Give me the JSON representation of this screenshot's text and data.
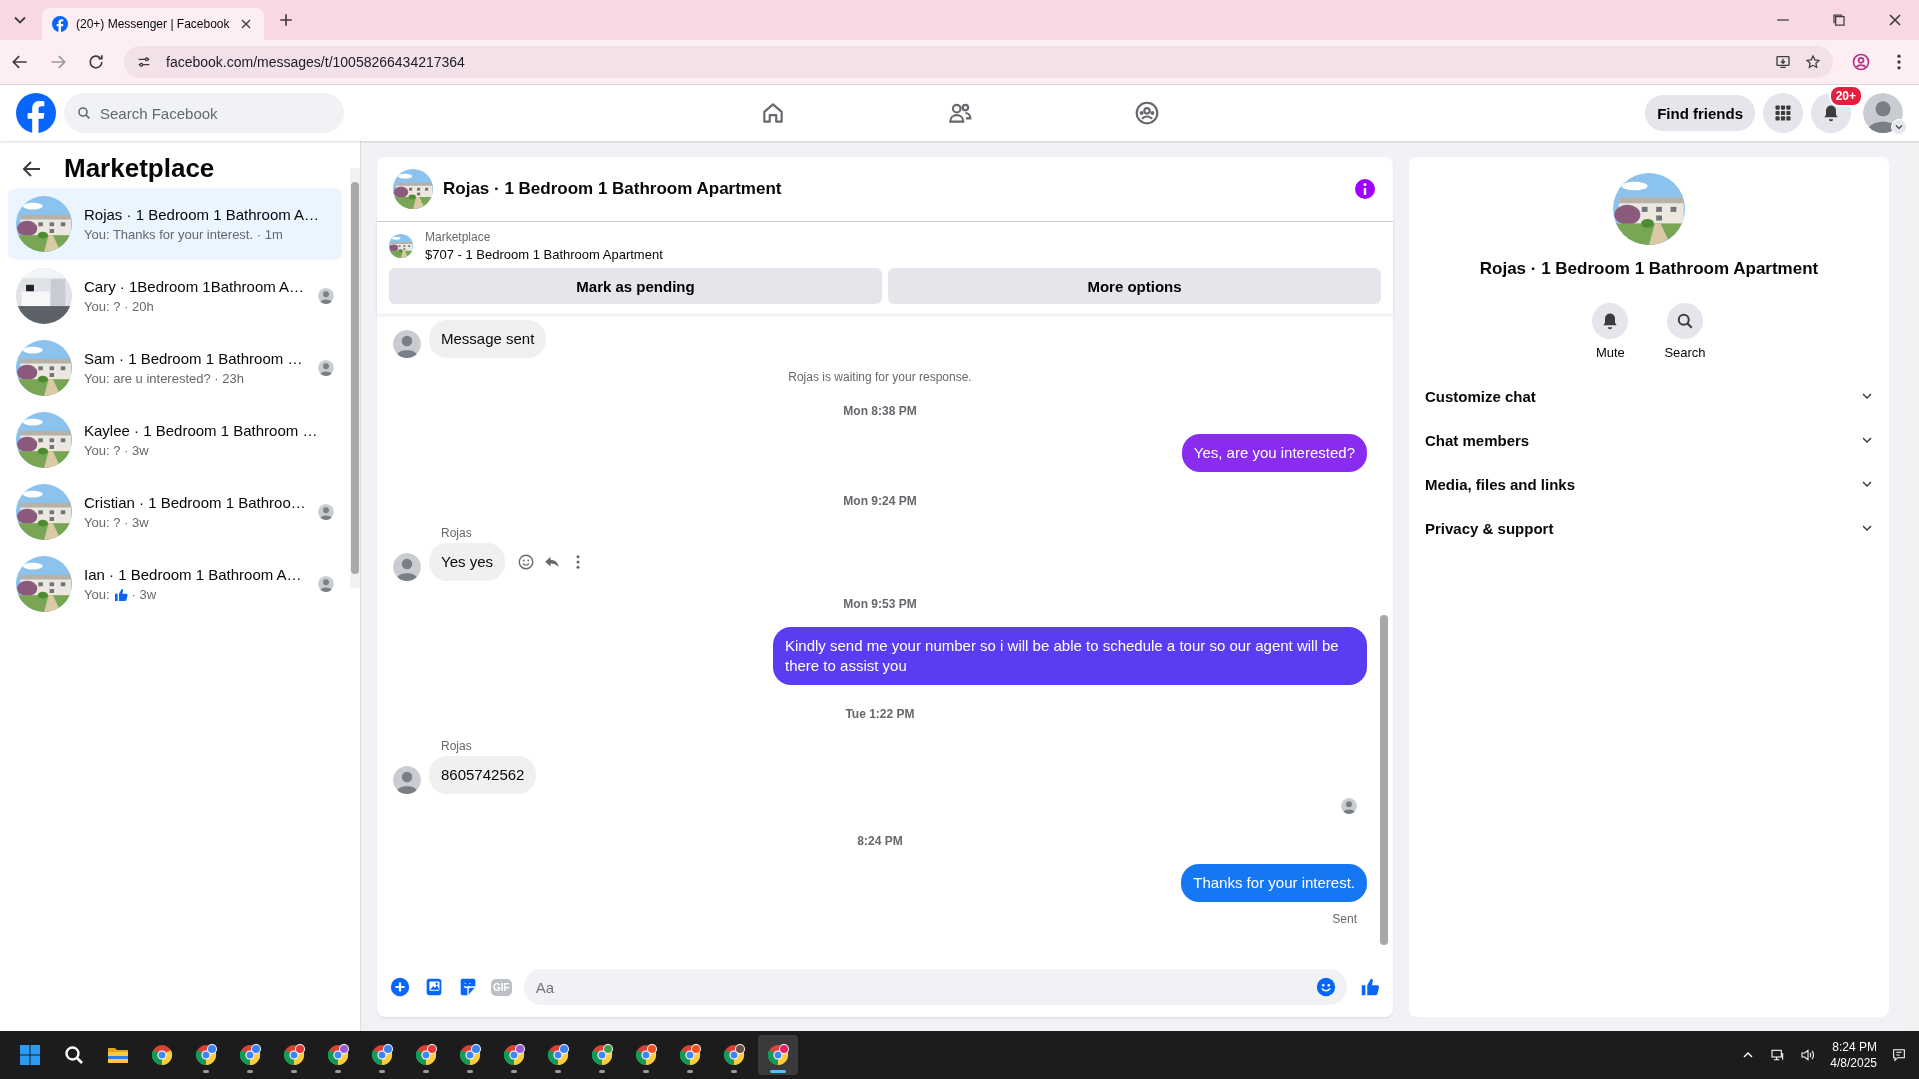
{
  "browser": {
    "tab": {
      "title": "(20+) Messenger | Facebook",
      "selected": true
    },
    "address": "facebook.com/messages/t/10058266434217364"
  },
  "header": {
    "search": {
      "placeholder": "Search Facebook"
    },
    "find_friends": "Find friends",
    "notifications_badge": "20+"
  },
  "sidebar": {
    "title": "Marketplace",
    "conversations": [
      {
        "name": "Rojas · 1 Bedroom 1 Bathroom A…",
        "kind": "text",
        "preview": "You: Thanks for your interest. · 1m",
        "selected": true,
        "seen": false
      },
      {
        "name": "Cary · 1Bedroom 1Bathroom A…",
        "kind": "text",
        "preview": "You: ? · 20h",
        "selected": false,
        "seen": true
      },
      {
        "name": "Sam · 1 Bedroom 1 Bathroom …",
        "kind": "text",
        "preview": "You: are u interested? · 23h",
        "selected": false,
        "seen": true
      },
      {
        "name": "Kaylee · 1 Bedroom 1 Bathroom …",
        "kind": "text",
        "preview": "You: ? · 3w",
        "selected": false,
        "seen": false
      },
      {
        "name": "Cristian · 1 Bedroom 1 Bathroo…",
        "kind": "text",
        "preview": "You: ? · 3w",
        "selected": false,
        "seen": true
      },
      {
        "name": "Ian · 1 Bedroom 1 Bathroom A…",
        "kind": "reaction",
        "preview": "You:",
        "preview_end": "· 3w",
        "selected": false,
        "seen": true
      }
    ]
  },
  "chat": {
    "title": "Rojas · 1 Bedroom 1 Bathroom Apartment",
    "listing": {
      "label": "Marketplace",
      "item": "$707 - 1 Bedroom 1 Bathroom Apartment"
    },
    "buttons": [
      "Mark as pending",
      "More options"
    ],
    "messages": [
      {
        "kind": "incoming",
        "text": "Message sent",
        "actions": false
      },
      {
        "kind": "notice",
        "text": "Rojas is waiting for your response."
      },
      {
        "kind": "time",
        "text": "Mon 8:38 PM"
      },
      {
        "kind": "outgoing",
        "text": "Yes, are you interested?",
        "color": "#8a2cf0"
      },
      {
        "kind": "time",
        "text": "Mon 9:24 PM"
      },
      {
        "kind": "incoming",
        "sender": "Rojas",
        "text": "Yes yes",
        "actions": true
      },
      {
        "kind": "time",
        "text": "Mon 9:53 PM"
      },
      {
        "kind": "outgoing",
        "text": "Kindly send me your number so i will be able to schedule a tour so our agent will be there to assist you",
        "color": "#5b3cf2"
      },
      {
        "kind": "time",
        "text": "Tue 1:22 PM"
      },
      {
        "kind": "incoming",
        "sender": "Rojas",
        "text": "8605742562",
        "actions": false
      },
      {
        "kind": "seen"
      },
      {
        "kind": "time",
        "text": "8:24 PM"
      },
      {
        "kind": "outgoing",
        "text": "Thanks for your interest.",
        "color": "#1677f2"
      },
      {
        "kind": "receipt",
        "text": "Sent"
      }
    ],
    "composer": {
      "placeholder": "Aa",
      "gif": "GIF"
    }
  },
  "details": {
    "title": "Rojas · 1 Bedroom 1 Bathroom Apartment",
    "actions": [
      {
        "kind": "mute",
        "label": "Mute"
      },
      {
        "kind": "search",
        "label": "Search"
      }
    ],
    "sections": [
      {
        "label": "Customize chat",
        "expanded": false
      },
      {
        "label": "Chat members",
        "expanded": false
      },
      {
        "label": "Media, files and links",
        "expanded": false
      },
      {
        "label": "Privacy & support",
        "expanded": false
      }
    ]
  },
  "taskbar": {
    "apps": [
      {
        "kind": "start",
        "selected": false
      },
      {
        "kind": "search",
        "selected": false
      },
      {
        "kind": "folder",
        "selected": false
      },
      {
        "kind": "chrome",
        "selected": false
      },
      {
        "kind": "chrome-profile",
        "color": "#3b82f6",
        "selected": false
      },
      {
        "kind": "chrome-profile",
        "color": "#3b82f6",
        "selected": false
      },
      {
        "kind": "chrome-profile",
        "color": "#e53935",
        "selected": false
      },
      {
        "kind": "chrome-profile",
        "color": "#9c5bd6",
        "selected": false
      },
      {
        "kind": "chrome-profile",
        "color": "#3b82f6",
        "selected": false
      },
      {
        "kind": "chrome-profile",
        "color": "#e53935",
        "selected": false
      },
      {
        "kind": "chrome-profile",
        "color": "#3b82f6",
        "selected": false
      },
      {
        "kind": "chrome-profile",
        "color": "#9c5bd6",
        "selected": false
      },
      {
        "kind": "chrome-profile",
        "color": "#3b82f6",
        "selected": false
      },
      {
        "kind": "chrome-profile",
        "color": "#43a047",
        "selected": false
      },
      {
        "kind": "chrome-profile",
        "color": "#f4511e",
        "selected": false
      },
      {
        "kind": "chrome-profile",
        "color": "#f4511e",
        "selected": false
      },
      {
        "kind": "chrome-profile",
        "color": "#6d4c41",
        "selected": false
      },
      {
        "kind": "chrome-profile",
        "color": "#e91e63",
        "selected": true
      }
    ],
    "time": "8:24 PM",
    "date": "4/8/2025"
  }
}
